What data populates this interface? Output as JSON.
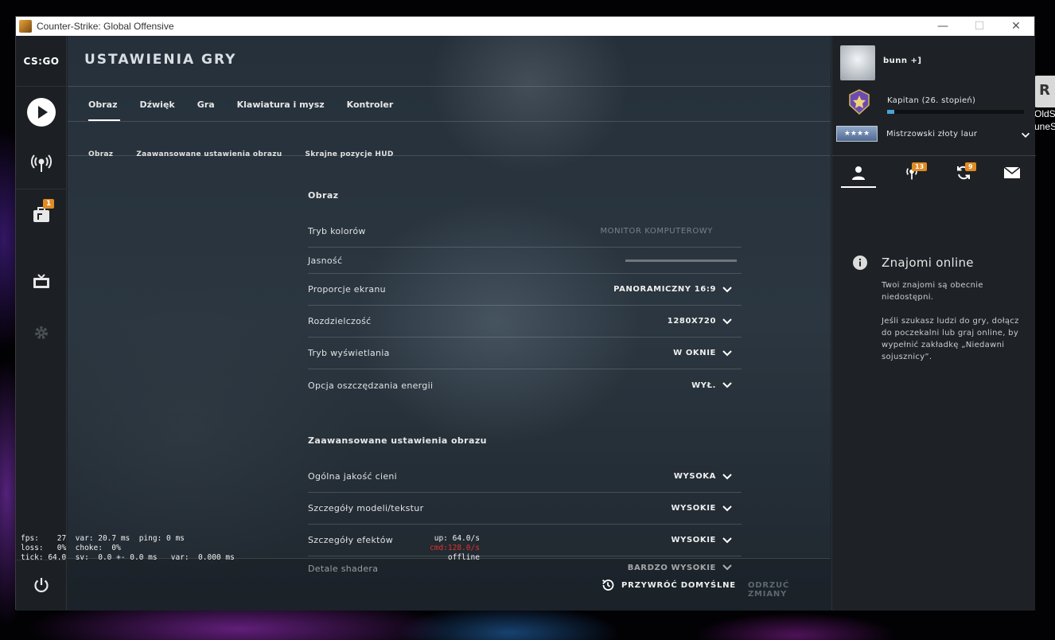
{
  "window": {
    "title": "Counter-Strike: Global Offensive",
    "minimize": "—",
    "maximize": "☐",
    "close": "✕"
  },
  "desktop": {
    "shortcut_label_1": "OldSc",
    "shortcut_label_2": "uneS"
  },
  "leftnav": {
    "logo": "CS:GO",
    "inventory_badge": "1"
  },
  "header": {
    "title": "USTAWIENIA GRY"
  },
  "tabs": [
    {
      "label": "Obraz",
      "active": true
    },
    {
      "label": "Dźwięk"
    },
    {
      "label": "Gra"
    },
    {
      "label": "Klawiatura i mysz"
    },
    {
      "label": "Kontroler"
    }
  ],
  "subtabs": [
    "Obraz",
    "Zaawansowane ustawienia obrazu",
    "Skrajne pozycje HUD"
  ],
  "sections": {
    "image": {
      "heading": "Obraz",
      "rows": [
        {
          "label": "Tryb kolorów",
          "value": "MONITOR KOMPUTEROWY"
        },
        {
          "label": "Jasność"
        },
        {
          "label": "Proporcje ekranu",
          "value": "PANORAMICZNY 16:9"
        },
        {
          "label": "Rozdzielczość",
          "value": "1280X720"
        },
        {
          "label": "Tryb wyświetlania",
          "value": "W OKNIE"
        },
        {
          "label": "Opcja oszczędzania energii",
          "value": "WYŁ."
        }
      ]
    },
    "advanced": {
      "heading": "Zaawansowane ustawienia obrazu",
      "rows": [
        {
          "label": "Ogólna jakość cieni",
          "value": "WYSOKA"
        },
        {
          "label": "Szczegóły modeli/tekstur",
          "value": "WYSOKIE"
        },
        {
          "label": "Szczegóły efektów",
          "value": "WYSOKIE"
        },
        {
          "label": "Detale shadera",
          "value": "BARDZO WYSOKIE"
        }
      ]
    }
  },
  "footer": {
    "restore_label": "PRZYWRÓĆ DOMYŚLNE",
    "discard_label": "ODRZUĆ ZMIANY"
  },
  "netgraph": {
    "line1": "fps:    27  var: 20.7 ms  ping: 0 ms",
    "line2": "loss:   0%  choke:  0%",
    "line3": "tick: 64.0  sv:  0.0 +- 0.0 ms   var:  0.000 ms",
    "up": "up: 64.0/s",
    "cmd": "cmd:128.0/s",
    "status": "offline"
  },
  "profile": {
    "name": "bunn +]",
    "rank": "Kapitan (26. stopień)",
    "rank_progress": 0.05,
    "skill_group": "Mistrzowski złoty laur",
    "skill_emblem": "★★★★"
  },
  "panel_tabs": {
    "news_badge": "13",
    "activity_badge": "9"
  },
  "friends_info": {
    "title": "Znajomi online",
    "para1": "Twoi znajomi są obecnie niedostępni.",
    "para2": "Jeśli szukasz ludzi do gry, dołącz do poczekalni lub graj online, by wypełnić zakładkę „Niedawni sojusznicy”."
  }
}
